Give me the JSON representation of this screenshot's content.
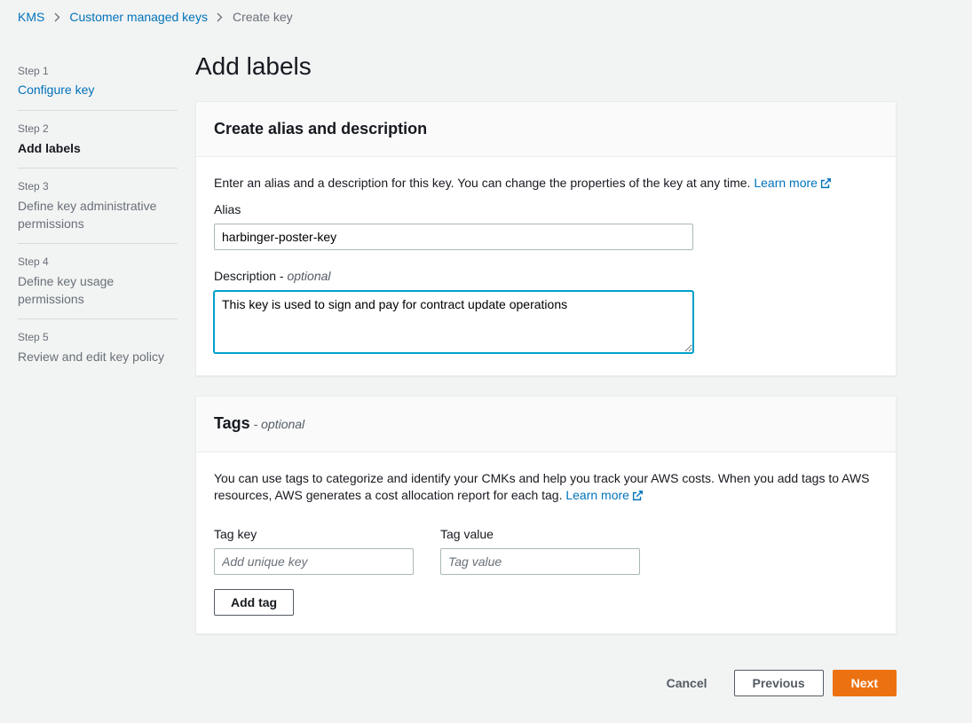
{
  "breadcrumb": {
    "root": "KMS",
    "section": "Customer managed keys",
    "current": "Create key"
  },
  "sidebar": {
    "steps": [
      {
        "num": "Step 1",
        "label": "Configure key"
      },
      {
        "num": "Step 2",
        "label": "Add labels"
      },
      {
        "num": "Step 3",
        "label": "Define key administrative permissions"
      },
      {
        "num": "Step 4",
        "label": "Define key usage permissions"
      },
      {
        "num": "Step 5",
        "label": "Review and edit key policy"
      }
    ]
  },
  "page": {
    "title": "Add labels"
  },
  "alias_panel": {
    "heading": "Create alias and description",
    "intro": "Enter an alias and a description for this key. You can change the properties of the key at any time. ",
    "learn_more": "Learn more",
    "alias_label": "Alias",
    "alias_value": "harbinger-poster-key",
    "description_label_main": "Description - ",
    "description_label_optional": "optional",
    "description_value": "This key is used to sign and pay for contract update operations"
  },
  "tags_panel": {
    "heading": "Tags",
    "heading_suffix": " - optional",
    "intro": "You can use tags to categorize and identify your CMKs and help you track your AWS costs. When you add tags to AWS resources, AWS generates a cost allocation report for each tag. ",
    "learn_more": "Learn more",
    "tag_key_label": "Tag key",
    "tag_value_label": "Tag value",
    "tag_key_placeholder": "Add unique key",
    "tag_value_placeholder": "Tag value",
    "add_tag_button": "Add tag"
  },
  "footer": {
    "cancel": "Cancel",
    "previous": "Previous",
    "next": "Next"
  }
}
